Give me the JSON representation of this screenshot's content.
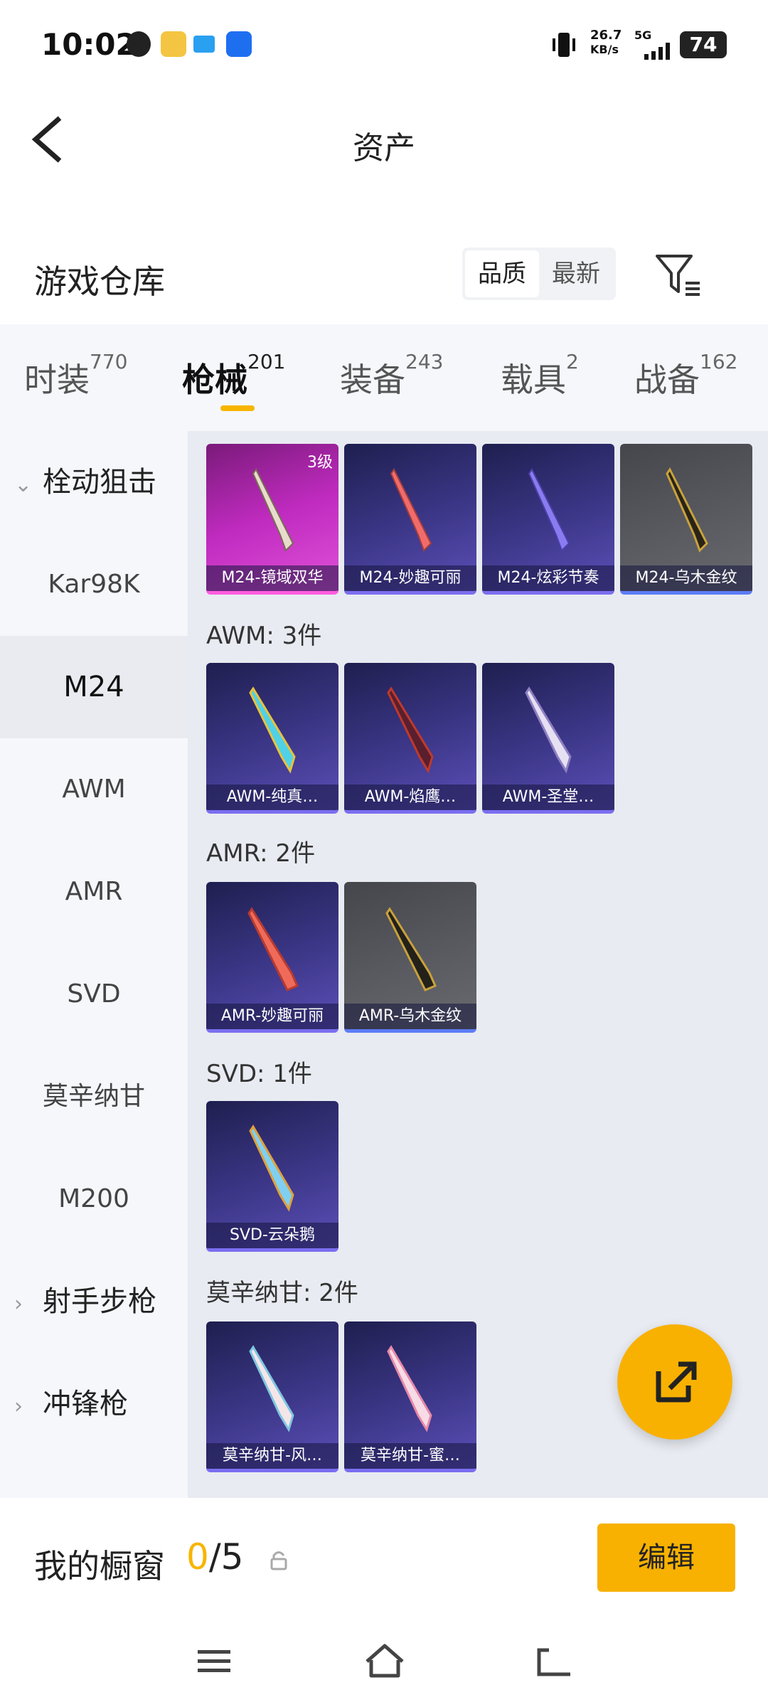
{
  "status_bar": {
    "time": "10:02",
    "net_speed": "26.7",
    "net_unit": "KB/s",
    "network": "5G",
    "battery": "74"
  },
  "header": {
    "title": "资产"
  },
  "warehouse": {
    "title": "游戏仓库",
    "sort_options": [
      "品质",
      "最新"
    ],
    "active_sort": "品质"
  },
  "tabs": [
    {
      "label": "时装",
      "count": "770"
    },
    {
      "label": "枪械",
      "count": "201"
    },
    {
      "label": "装备",
      "count": "243"
    },
    {
      "label": "载具",
      "count": "2"
    },
    {
      "label": "战备",
      "count": "162"
    }
  ],
  "sidenav": {
    "groups": [
      {
        "label": "栓动狙击",
        "expanded": true
      },
      {
        "label": "射手步枪",
        "expanded": false
      },
      {
        "label": "冲锋枪",
        "expanded": false
      }
    ],
    "items": [
      "Kar98K",
      "M24",
      "AWM",
      "AMR",
      "SVD",
      "莫辛纳甘",
      "M200"
    ],
    "active_item": "M24"
  },
  "weapon_groups": {
    "m24": {
      "items": [
        {
          "label": "M24-镜域双华",
          "rarity": "pink",
          "badge": "3级"
        },
        {
          "label": "M24-妙趣可丽",
          "rarity": "purple"
        },
        {
          "label": "M24-炫彩节奏",
          "rarity": "purple"
        },
        {
          "label": "M24-乌木金纹",
          "rarity": "gray"
        }
      ]
    },
    "awm": {
      "title": "AWM: 3件",
      "items": [
        {
          "label": "AWM-纯真…",
          "rarity": "purple"
        },
        {
          "label": "AWM-焰鹰…",
          "rarity": "purple"
        },
        {
          "label": "AWM-圣堂…",
          "rarity": "purple"
        }
      ]
    },
    "amr": {
      "title": "AMR: 2件",
      "items": [
        {
          "label": "AMR-妙趣可丽",
          "rarity": "purple"
        },
        {
          "label": "AMR-乌木金纹",
          "rarity": "gray"
        }
      ]
    },
    "svd": {
      "title": "SVD: 1件",
      "items": [
        {
          "label": "SVD-云朵鹅",
          "rarity": "purple"
        }
      ]
    },
    "mosin": {
      "title": "莫辛纳甘: 2件",
      "items": [
        {
          "label": "莫辛纳甘-风…",
          "rarity": "purple"
        },
        {
          "label": "莫辛纳甘-蜜…",
          "rarity": "purple"
        }
      ]
    }
  },
  "showcase": {
    "label": "我的橱窗",
    "current": "0",
    "total": "/5",
    "edit_label": "编辑"
  },
  "colors": {
    "accent": "#f8b100",
    "pink_rarity": "#c02bc0",
    "purple_rarity": "#3a3584",
    "gray_rarity": "#5b5c62"
  }
}
